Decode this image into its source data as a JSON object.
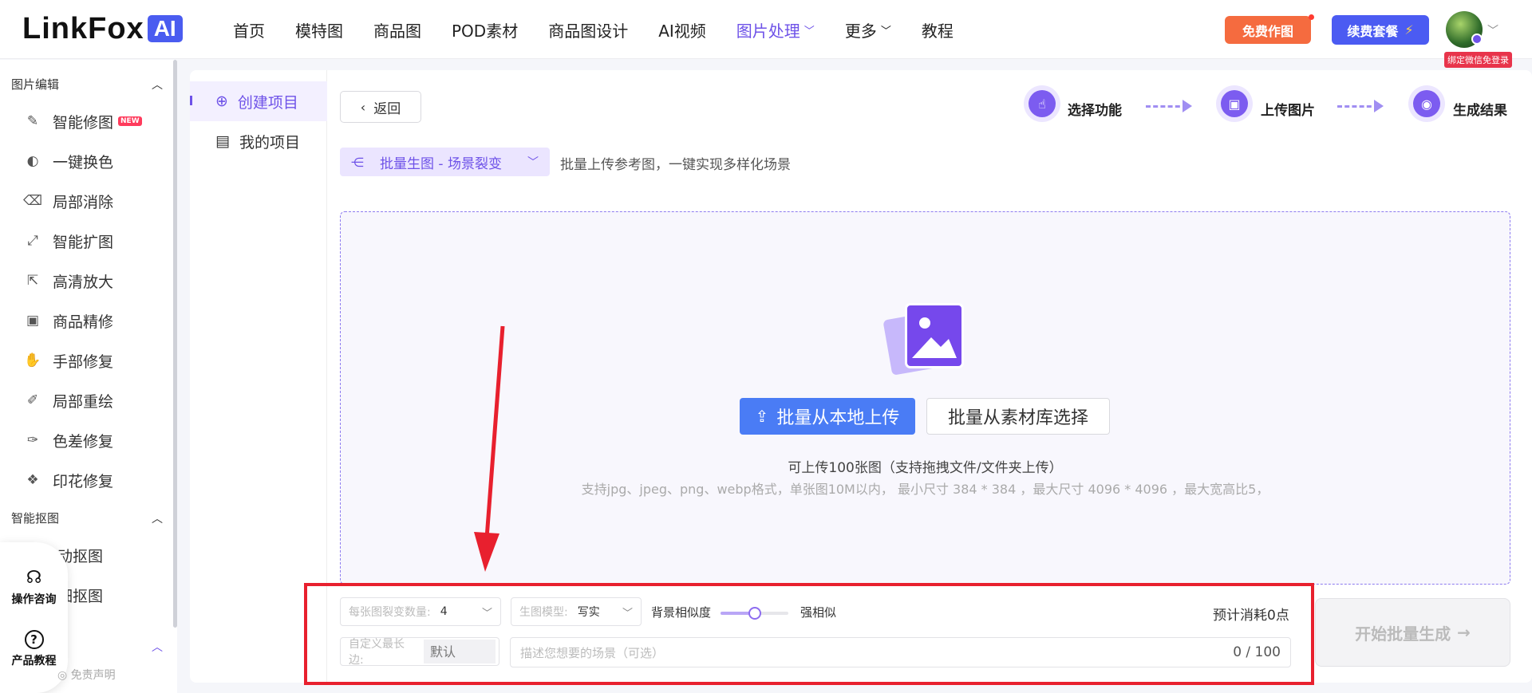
{
  "header": {
    "logo_text": "LinkFox",
    "logo_ai": "AI",
    "nav": [
      {
        "label": "首页",
        "active": false,
        "chevron": false
      },
      {
        "label": "模特图",
        "active": false,
        "chevron": false
      },
      {
        "label": "商品图",
        "active": false,
        "chevron": false
      },
      {
        "label": "POD素材",
        "active": false,
        "chevron": false
      },
      {
        "label": "商品图设计",
        "active": false,
        "chevron": false
      },
      {
        "label": "AI视频",
        "active": false,
        "chevron": false
      },
      {
        "label": "图片处理",
        "active": true,
        "chevron": true
      },
      {
        "label": "更多",
        "active": false,
        "chevron": true
      },
      {
        "label": "教程",
        "active": false,
        "chevron": false
      }
    ],
    "free_button": "免费作图",
    "renew_button": "续费套餐",
    "renew_icon": "⚡",
    "wechat_tag": "绑定微信免登录"
  },
  "sidebar": {
    "sections": [
      {
        "title": "图片编辑",
        "items": [
          {
            "label": "智能修图",
            "icon": "wand-icon",
            "glyph": "✎",
            "badge": "NEW"
          },
          {
            "label": "一键换色",
            "icon": "palette-icon",
            "glyph": "◐"
          },
          {
            "label": "局部消除",
            "icon": "eraser-icon",
            "glyph": "⌫"
          },
          {
            "label": "智能扩图",
            "icon": "expand-icon",
            "glyph": "⤢"
          },
          {
            "label": "高清放大",
            "icon": "zoom-icon",
            "glyph": "⇱"
          },
          {
            "label": "商品精修",
            "icon": "product-retouch-icon",
            "glyph": "▣"
          },
          {
            "label": "手部修复",
            "icon": "hand-icon",
            "glyph": "✋"
          },
          {
            "label": "局部重绘",
            "icon": "brush-icon",
            "glyph": "✐"
          },
          {
            "label": "色差修复",
            "icon": "dropper-icon",
            "glyph": "✑"
          },
          {
            "label": "印花修复",
            "icon": "pattern-icon",
            "glyph": "❖"
          }
        ]
      },
      {
        "title": "智能抠图",
        "items": [
          {
            "label": "动抠图",
            "icon": "cutout-icon",
            "glyph": ""
          },
          {
            "label": "细抠图",
            "icon": "fine-cutout-icon",
            "glyph": ""
          }
        ]
      }
    ],
    "float": [
      {
        "label": "操作咨询",
        "icon": "headset-icon",
        "glyph": "🎧"
      },
      {
        "label": "产品教程",
        "icon": "help-icon",
        "glyph": "?"
      }
    ],
    "disclaimer": "免责声明"
  },
  "projects": {
    "create": "创建项目",
    "mine": "我的项目"
  },
  "main": {
    "back": "返回",
    "steps": [
      "选择功能",
      "上传图片",
      "生成结果"
    ],
    "mode": "批量生图 - 场景裂变",
    "mode_desc": "批量上传参考图，一键实现多样化场景",
    "upload_local": "批量从本地上传",
    "upload_library": "批量从素材库选择",
    "hint1": "可上传100张图（支持拖拽文件/文件夹上传）",
    "hint2": "支持jpg、jpeg、png、webp格式，单张图10M以内， 最小尺寸 384 * 384 ，最大尺寸 4096 * 4096 ，最大宽高比5，"
  },
  "settings": {
    "variants_label": "每张图裂变数量:",
    "variants_value": "4",
    "model_label": "生图模型:",
    "model_value": "写实",
    "similarity_label": "背景相似度",
    "similarity_right": "强相似",
    "similarity_level": 0.5,
    "cost": "预计消耗0点",
    "max_edge_label": "自定义最长边:",
    "max_edge_placeholder": "默认",
    "prompt_placeholder": "描述您想要的场景（可选）",
    "prompt_count": "0 / 100",
    "start_button": "开始批量生成"
  },
  "colors": {
    "accent": "#6e52e8",
    "primary_blue": "#4a7cf5",
    "annotation_red": "#e8202e"
  }
}
